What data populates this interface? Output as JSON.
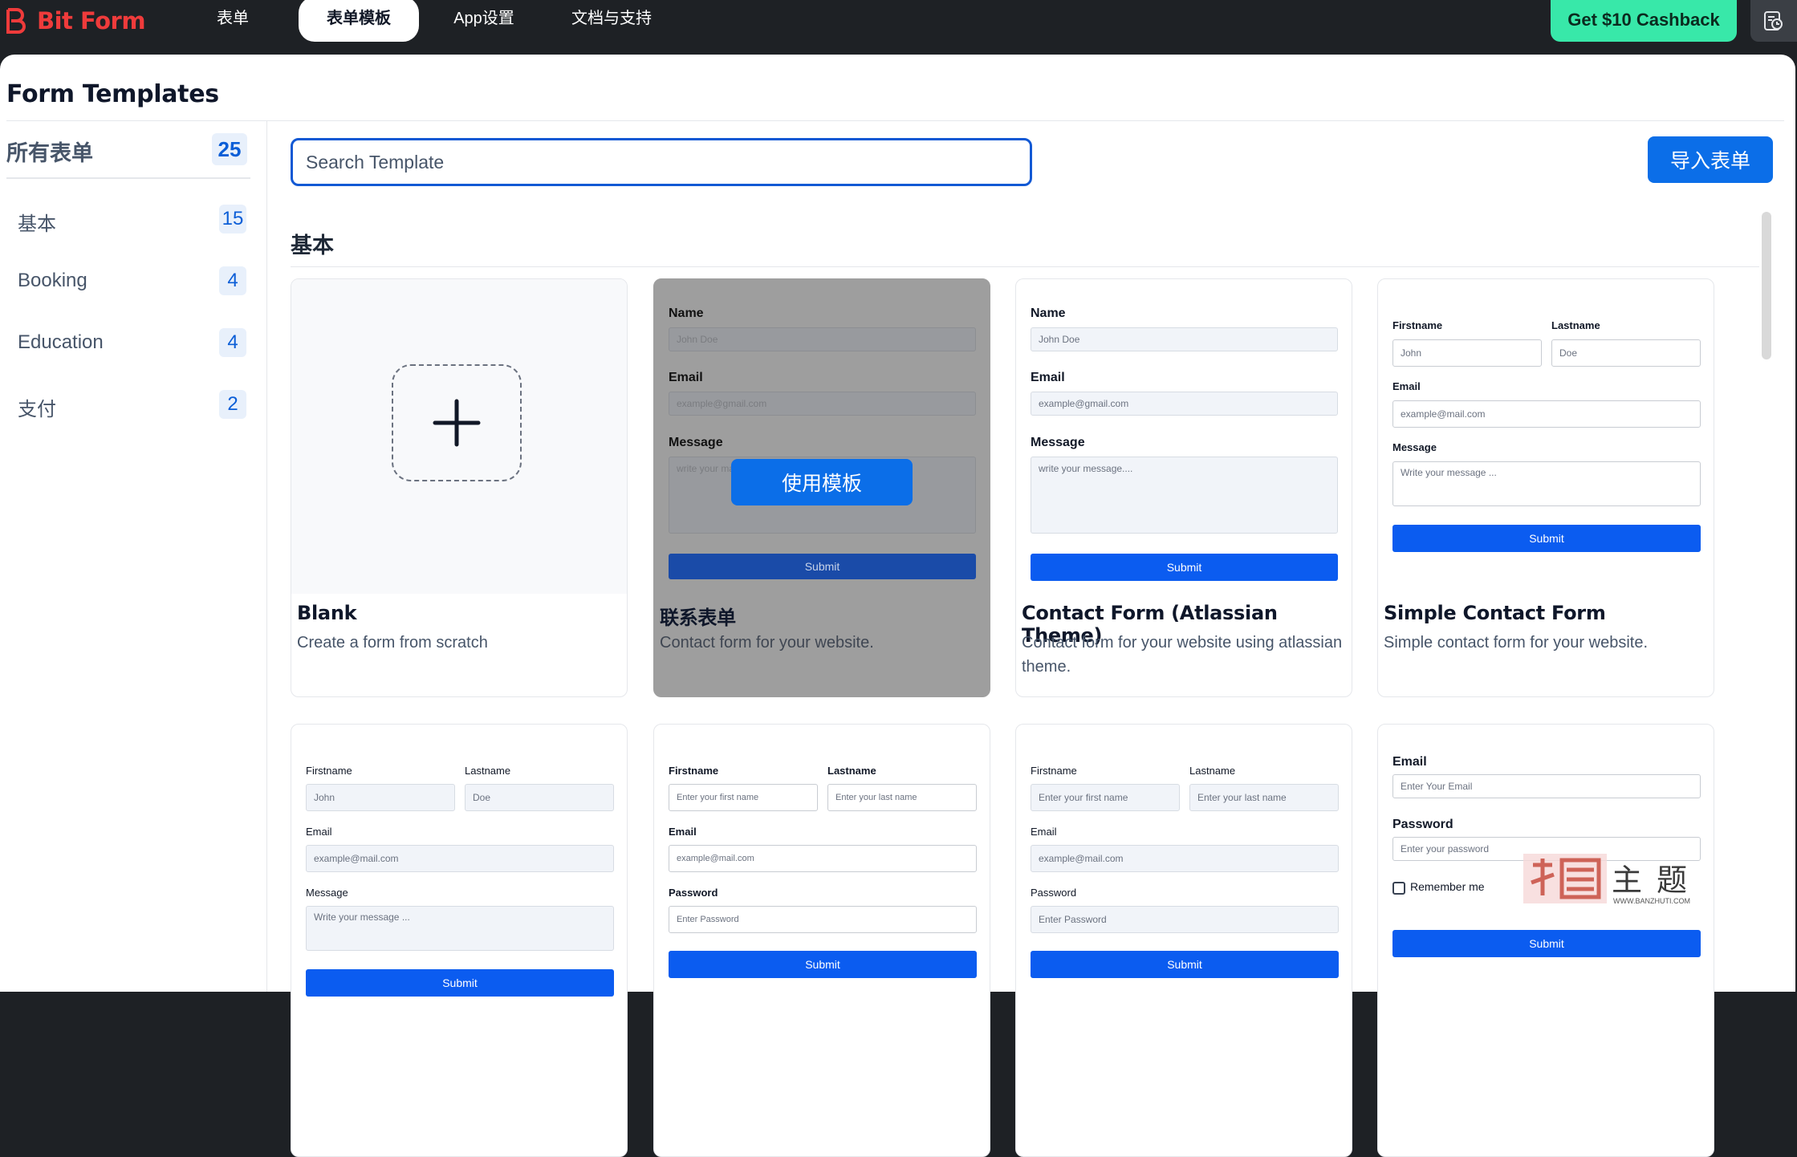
{
  "app": {
    "name": "Bit Form"
  },
  "nav": {
    "items": [
      {
        "label": "表单"
      },
      {
        "label": "表单模板"
      },
      {
        "label": "App设置"
      },
      {
        "label": "文档与支持"
      }
    ],
    "cashback_label": "Get $10 Cashback"
  },
  "page": {
    "title": "Form Templates"
  },
  "sidebar": {
    "all": {
      "label": "所有表单",
      "count": "25"
    },
    "categories": [
      {
        "label": "基本",
        "count": "15"
      },
      {
        "label": "Booking",
        "count": "4"
      },
      {
        "label": "Education",
        "count": "4"
      },
      {
        "label": "支付",
        "count": "2"
      }
    ]
  },
  "search": {
    "placeholder": "Search Template"
  },
  "import_label": "导入表单",
  "section": {
    "title": "基本"
  },
  "hover_action": "使用模板",
  "templates": [
    {
      "name": "Blank",
      "desc": "Create a form from scratch"
    },
    {
      "name": "联系表单",
      "desc": "Contact form for your website."
    },
    {
      "name": "Contact Form (Atlassian Theme)",
      "desc": "Contact form for your website using atlassian theme."
    },
    {
      "name": "Simple Contact Form",
      "desc": "Simple contact form for your website."
    }
  ],
  "mini": {
    "name": "Name",
    "email": "Email",
    "message": "Message",
    "firstname": "Firstname",
    "lastname": "Lastname",
    "password": "Password",
    "submit": "Submit",
    "remember": "Remember me",
    "ph_john_doe": "John Doe",
    "ph_gmail": "example@gmail.com",
    "ph_message": "write your message....",
    "ph_message_short": "write your ma",
    "ph_john": "John",
    "ph_doe": "Doe",
    "ph_mail": "example@mail.com",
    "ph_write_msg": "Write your message ...",
    "ph_first_lower": "Enter your first name",
    "ph_last_lower": "Enter your last name",
    "ph_password_cap": "Enter Password",
    "ph_first": "Enter your first name",
    "ph_last": "Enter your last name",
    "ph_email_cap": "Enter Your Email",
    "ph_password_lower": "Enter your password"
  },
  "watermark": {
    "text": "主题",
    "site": "WWW.BANZHUTI.COM"
  },
  "colors": {
    "brand": "#ef3b3b",
    "cashback": "#38e8a9",
    "primary": "#0b6ee8",
    "submit": "#0b5cf0"
  }
}
